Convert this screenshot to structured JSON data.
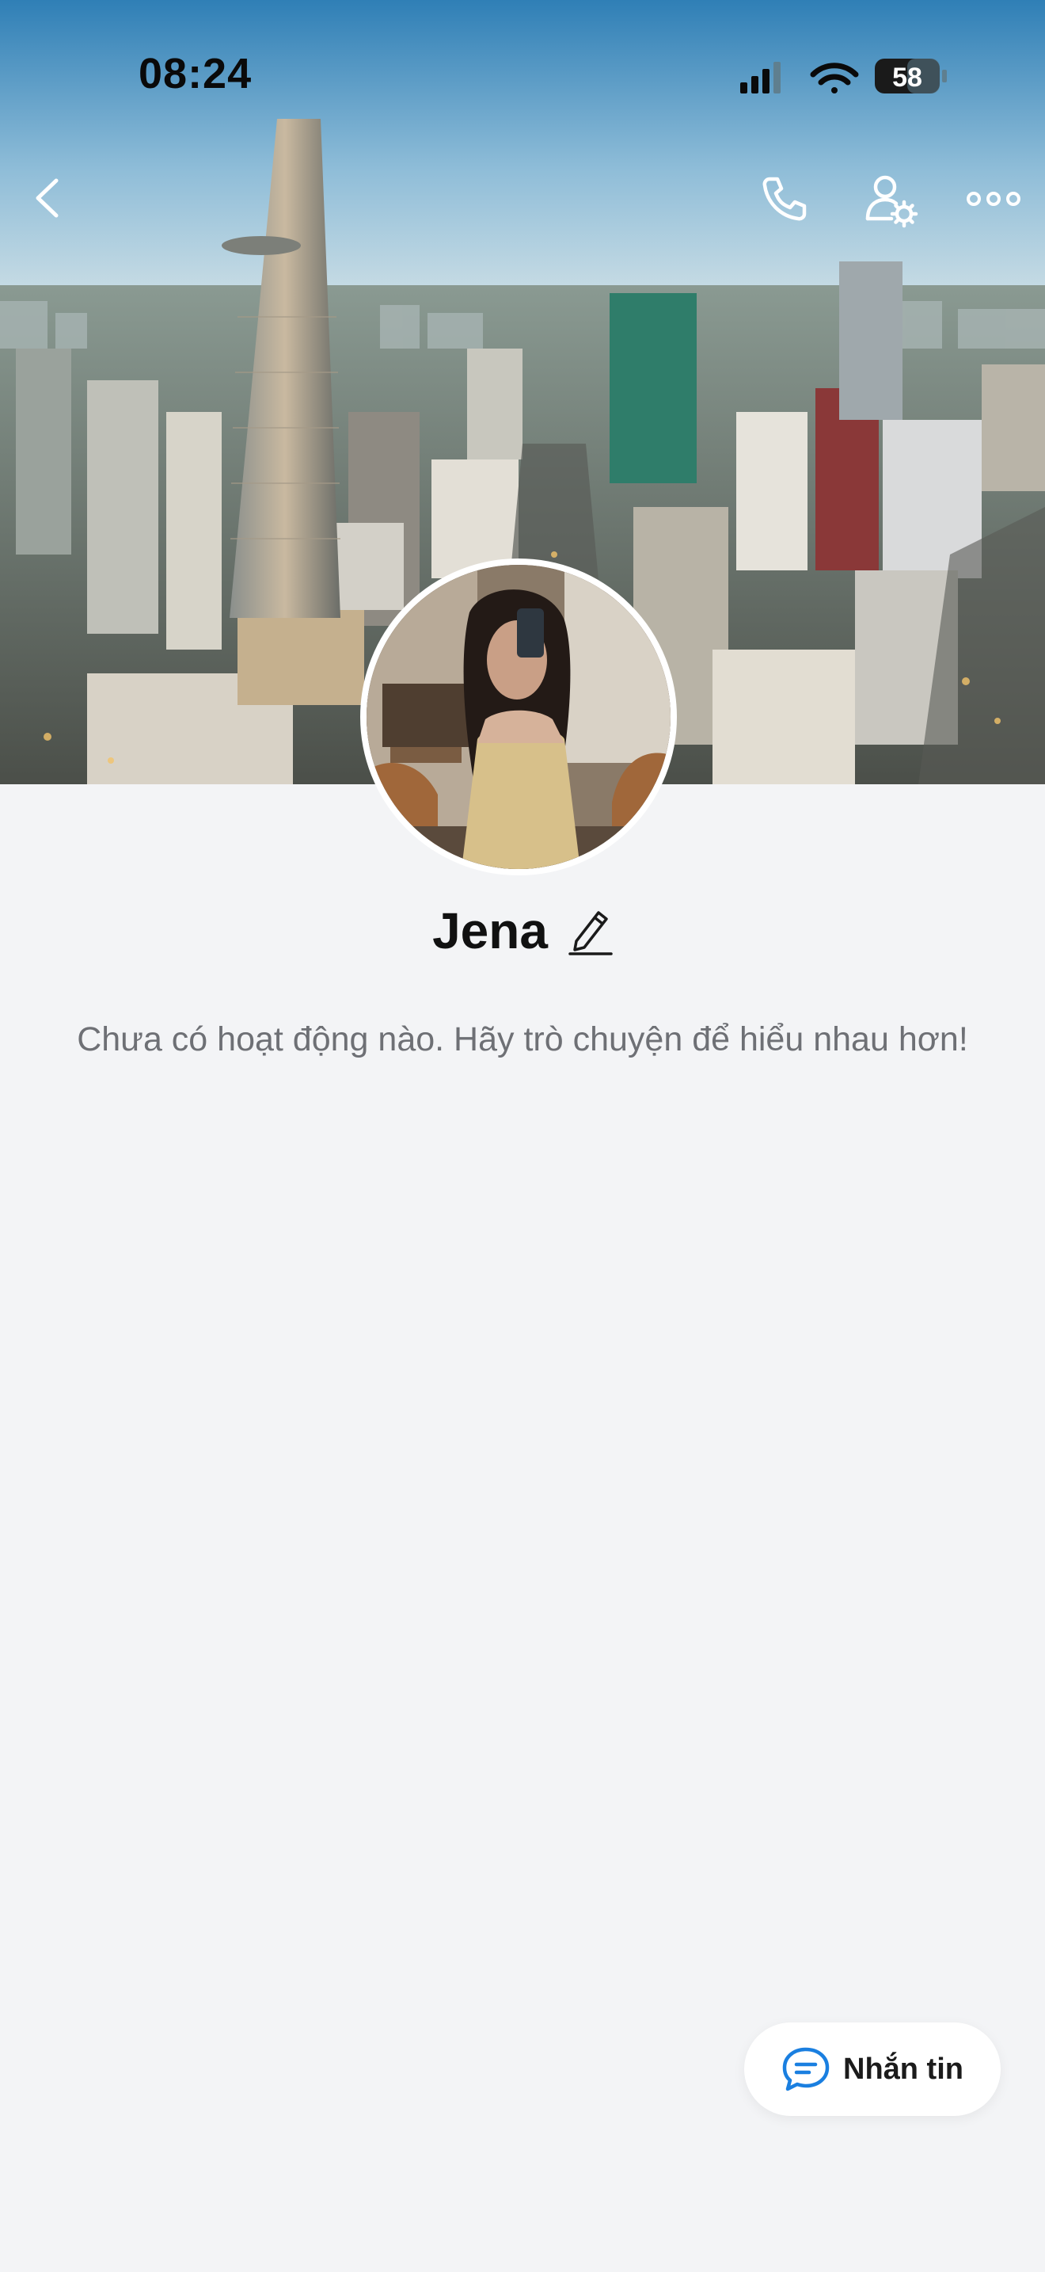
{
  "status_bar": {
    "time": "08:24",
    "battery": "58",
    "icons": [
      "cellular-signal-icon",
      "wifi-icon",
      "battery-icon"
    ]
  },
  "top_nav": {
    "back_icon": "chevron-left-icon",
    "call_icon": "phone-icon",
    "profile_settings_icon": "user-gear-icon",
    "more_icon": "more-horizontal-icon"
  },
  "cover": {
    "image": "city-skyline-photo"
  },
  "profile": {
    "avatar": "profile-photo",
    "name": "Jena",
    "edit_icon": "pencil-icon"
  },
  "feed": {
    "empty_message": "Chưa có hoạt động nào. Hãy trò chuyện để hiểu nhau hơn!"
  },
  "message_button": {
    "icon": "chat-bubble-icon",
    "label": "Nhắn tin"
  },
  "colors": {
    "background": "#f3f4f6",
    "accent": "#1a7fe0",
    "text_primary": "#111111",
    "text_secondary": "#6e7075"
  }
}
